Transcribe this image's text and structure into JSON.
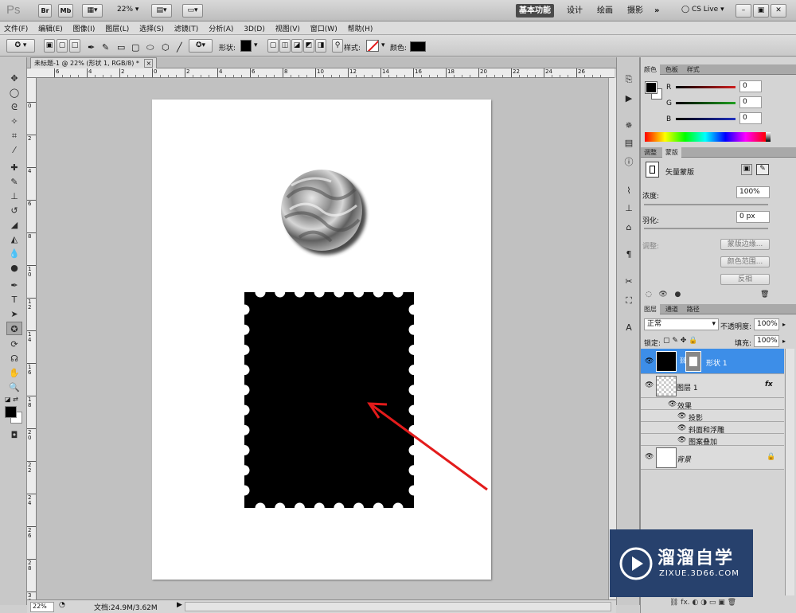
{
  "app": {
    "logo": "Ps",
    "zoom": "22%",
    "btn_br": "Br",
    "btn_mb": "Mb"
  },
  "workspaces": [
    {
      "label": "基本功能",
      "active": true
    },
    {
      "label": "设计",
      "active": false
    },
    {
      "label": "绘画",
      "active": false
    },
    {
      "label": "摄影",
      "active": false
    },
    {
      "label": "»",
      "active": false
    }
  ],
  "cs_live": "CS Live",
  "menu": [
    "文件(F)",
    "编辑(E)",
    "图像(I)",
    "图层(L)",
    "选择(S)",
    "滤镜(T)",
    "分析(A)",
    "3D(D)",
    "视图(V)",
    "窗口(W)",
    "帮助(H)"
  ],
  "options": {
    "shape_label": "形状:",
    "style_label": "样式:",
    "color_label": "颜色:"
  },
  "document": {
    "tab_title": "未标题-1 @ 22% (形状 1, RGB/8) *",
    "close": "×"
  },
  "ruler": {
    "top": [
      "6",
      "4",
      "2",
      "0",
      "2",
      "4",
      "6",
      "8",
      "10",
      "12",
      "14",
      "16",
      "18",
      "20",
      "22",
      "24",
      "26"
    ],
    "left": [
      "0",
      "2",
      "4",
      "6",
      "8",
      "10",
      "12",
      "14",
      "16",
      "18",
      "20",
      "22",
      "24",
      "26",
      "28",
      "30"
    ]
  },
  "status": {
    "zoom": "22%",
    "doc_info": "文档:24.9M/3.62M"
  },
  "color_panel": {
    "tabs": [
      "颜色",
      "色板",
      "样式"
    ],
    "channels": [
      {
        "label": "R",
        "value": "0",
        "color": "#d02020"
      },
      {
        "label": "G",
        "value": "0",
        "color": "#20a020"
      },
      {
        "label": "B",
        "value": "0",
        "color": "#2030c0"
      }
    ]
  },
  "masks_panel": {
    "tabs": [
      "调整",
      "蒙版"
    ],
    "mask_type": "矢量蒙版",
    "density_label": "浓度:",
    "density_value": "100%",
    "feather_label": "羽化:",
    "feather_value": "0 px",
    "refine_label": "调整:",
    "buttons": [
      "蒙版边缘...",
      "颜色范围...",
      "反相"
    ]
  },
  "layers_panel": {
    "tabs": [
      "图层",
      "通道",
      "路径"
    ],
    "blend_mode": "正常",
    "opacity_label": "不透明度:",
    "opacity_value": "100%",
    "lock_label": "锁定:",
    "fill_label": "填充:",
    "fill_value": "100%",
    "layers": [
      {
        "name": "形状 1",
        "selected": true
      },
      {
        "name": "图层 1",
        "selected": false,
        "fx": "fx"
      },
      {
        "name": "效果",
        "selected": false
      },
      {
        "name": "投影",
        "selected": false
      },
      {
        "name": "斜面和浮雕",
        "selected": false
      },
      {
        "name": "图案叠加",
        "selected": false
      },
      {
        "name": "背景",
        "selected": false
      }
    ]
  },
  "watermark": {
    "title": "溜溜自学",
    "subtitle": "ZIXUE.3D66.COM"
  },
  "colors": {
    "selected_layer": "#3d8ee8",
    "arrow": "#e31b1b",
    "accent": "#27416d"
  }
}
